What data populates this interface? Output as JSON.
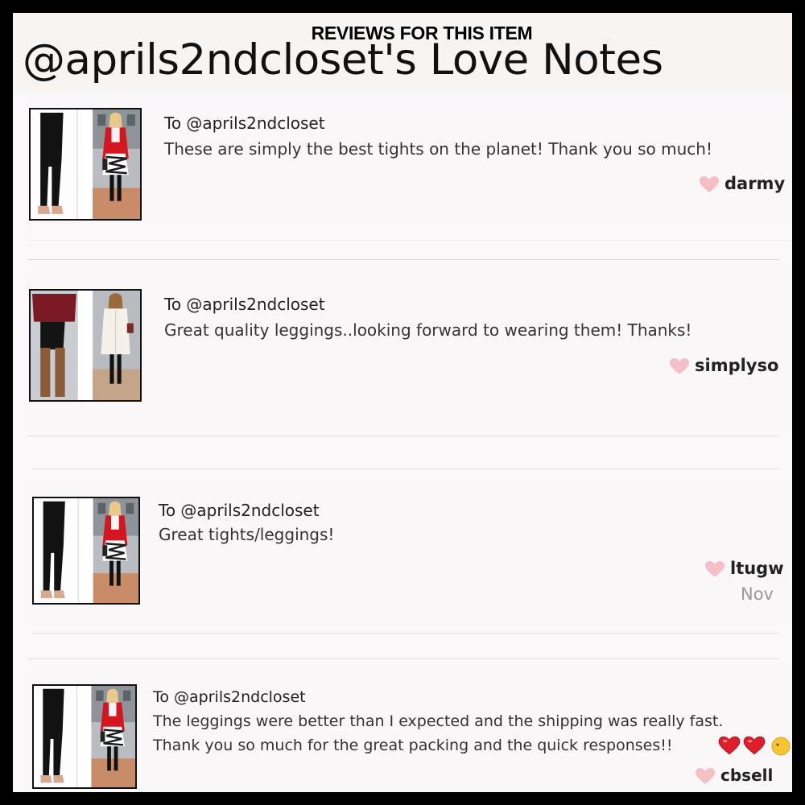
{
  "header": {
    "super_title": "REVIEWS FOR THIS ITEM",
    "title": "@aprils2ndcloset's Love Notes"
  },
  "reviews": [
    {
      "to": "To @aprils2ndcloset",
      "lines": [
        "These are simply the best tights on the planet! Thank you so much!"
      ],
      "user": "darmy",
      "date": "",
      "thumb": "black-leggings-and-red-coat-outfit"
    },
    {
      "to": "To @aprils2ndcloset",
      "lines": [
        "Great quality leggings..looking forward to wearing them! Thanks!"
      ],
      "user": "simplyso",
      "date": "",
      "thumb": "leggings-with-boots-and-white-coat-outfit"
    },
    {
      "to": "To @aprils2ndcloset",
      "lines": [
        "Great tights/leggings!"
      ],
      "user": "ltugw",
      "date": "Nov",
      "thumb": "black-leggings-and-red-coat-outfit"
    },
    {
      "to": "To @aprils2ndcloset",
      "lines": [
        "The leggings were better than I expected and the shipping was really fast.",
        "Thank you so much for the great packing and the quick responses!!"
      ],
      "user": "cbsell",
      "date": "",
      "thumb": "black-leggings-and-red-coat-outfit"
    }
  ],
  "colors": {
    "heart": "#f6bfc8",
    "red_heart_emoji": "#e01e2a",
    "divider": "#ddd9db"
  },
  "icons": {
    "like": "heart-icon",
    "emoji": "red-heart-emoji"
  }
}
